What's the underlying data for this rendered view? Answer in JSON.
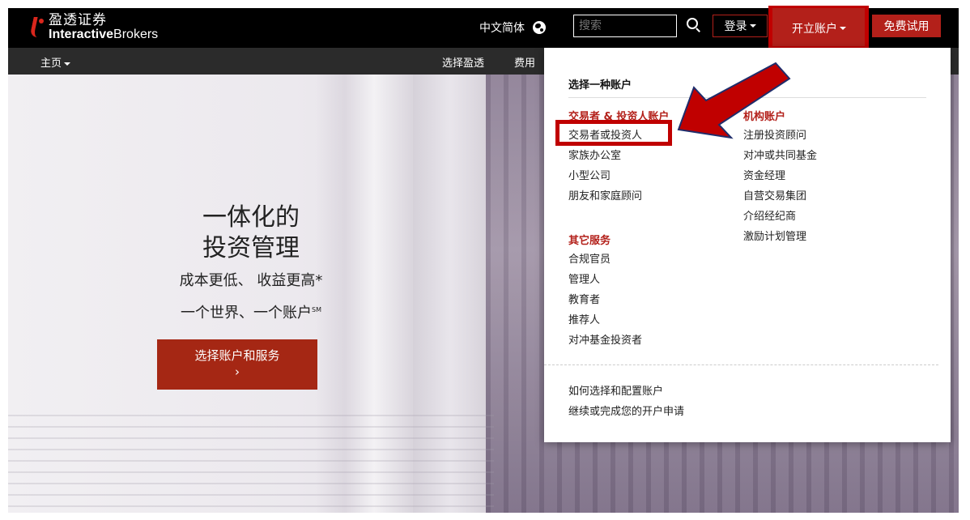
{
  "topbar": {
    "logo_cn": "盈透证券",
    "logo_en_bold": "Interactive",
    "logo_en_regular": "Brokers",
    "language": "中文简体",
    "search_placeholder": "搜索",
    "login_label": "登录",
    "open_account_label": "开立账户",
    "free_trial_label": "免费试用"
  },
  "navbar": {
    "home_label": "主页",
    "choose_label": "选择盈透",
    "fees_label": "费用"
  },
  "hero": {
    "title_line1": "一体化的",
    "title_line2": "投资管理",
    "sub_line1": "成本更低、 收益更高*",
    "sub_line2": "一个世界、一个账户",
    "sub_line2_mark": "SM",
    "cta_label": "选择账户和服务",
    "cta_arrow": "›"
  },
  "dropdown": {
    "heading": "选择一种账户",
    "traders_heading": "交易者 & 投资人账户",
    "traders_items": [
      "交易者或投资人",
      "家族办公室",
      "小型公司",
      "朋友和家庭顾问"
    ],
    "institution_heading": "机构账户",
    "institution_items": [
      "注册投资顾问",
      "对冲或共同基金",
      "资金经理",
      "自营交易集团",
      "介绍经纪商",
      "激励计划管理"
    ],
    "other_heading": "其它服务",
    "other_items": [
      "合规官员",
      "管理人",
      "教育者",
      "推荐人",
      "对冲基金投资者"
    ],
    "footer_items": [
      "如何选择和配置账户",
      "继续或完成您的开户申请"
    ]
  },
  "colors": {
    "brand_red": "#b3201a",
    "annotation_red": "#c00000",
    "topbar_bg": "#000000",
    "navbar_bg": "#2b2b2b"
  }
}
